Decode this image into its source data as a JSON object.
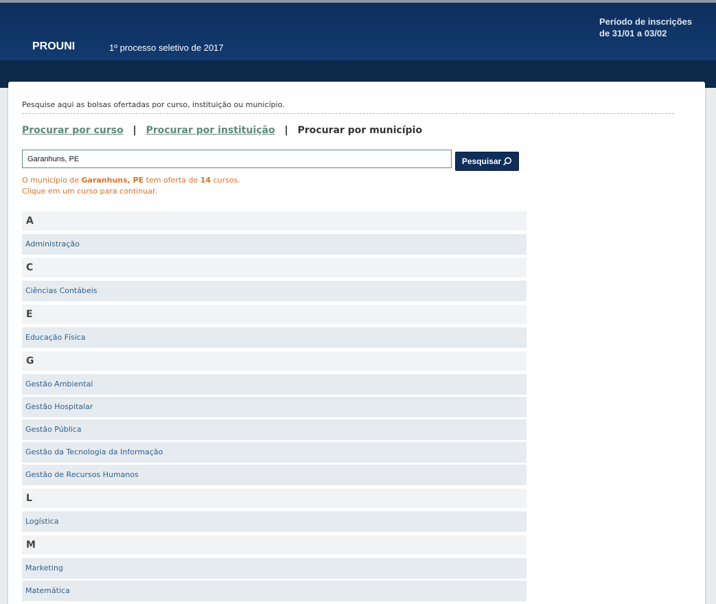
{
  "header": {
    "brand": "PROUNI",
    "subtitle": "1º processo seletivo de 2017",
    "period_line1": "Período de inscrições",
    "period_line2": "de 31/01 a 03/02"
  },
  "intro": "Pesquise aqui as bolsas ofertadas por curso, instituição ou município.",
  "tabs": {
    "curso": "Procurar por curso",
    "instituicao": "Procurar por instituição",
    "municipio": "Procurar por município",
    "separator": "|"
  },
  "search": {
    "value": "Garanhuns, PE",
    "button_label": "Pesquisar"
  },
  "result": {
    "prefix": "O município de ",
    "city": "Garanhuns, PE",
    "middle": " tem oferta de ",
    "count": "14",
    "suffix": " cursos.",
    "line2": "Clique em um curso para continuar."
  },
  "groups": [
    {
      "letter": "A",
      "courses": [
        "Administração"
      ]
    },
    {
      "letter": "C",
      "courses": [
        "Ciências Contábeis"
      ]
    },
    {
      "letter": "E",
      "courses": [
        "Educação Física"
      ]
    },
    {
      "letter": "G",
      "courses": [
        "Gestão Ambiental",
        "Gestão Hospitalar",
        "Gestão Pública",
        "Gestão da Tecnologia da Informação",
        "Gestão de Recursos Humanos"
      ]
    },
    {
      "letter": "L",
      "courses": [
        "Logística"
      ]
    },
    {
      "letter": "M",
      "courses": [
        "Marketing",
        "Matemática"
      ]
    }
  ]
}
